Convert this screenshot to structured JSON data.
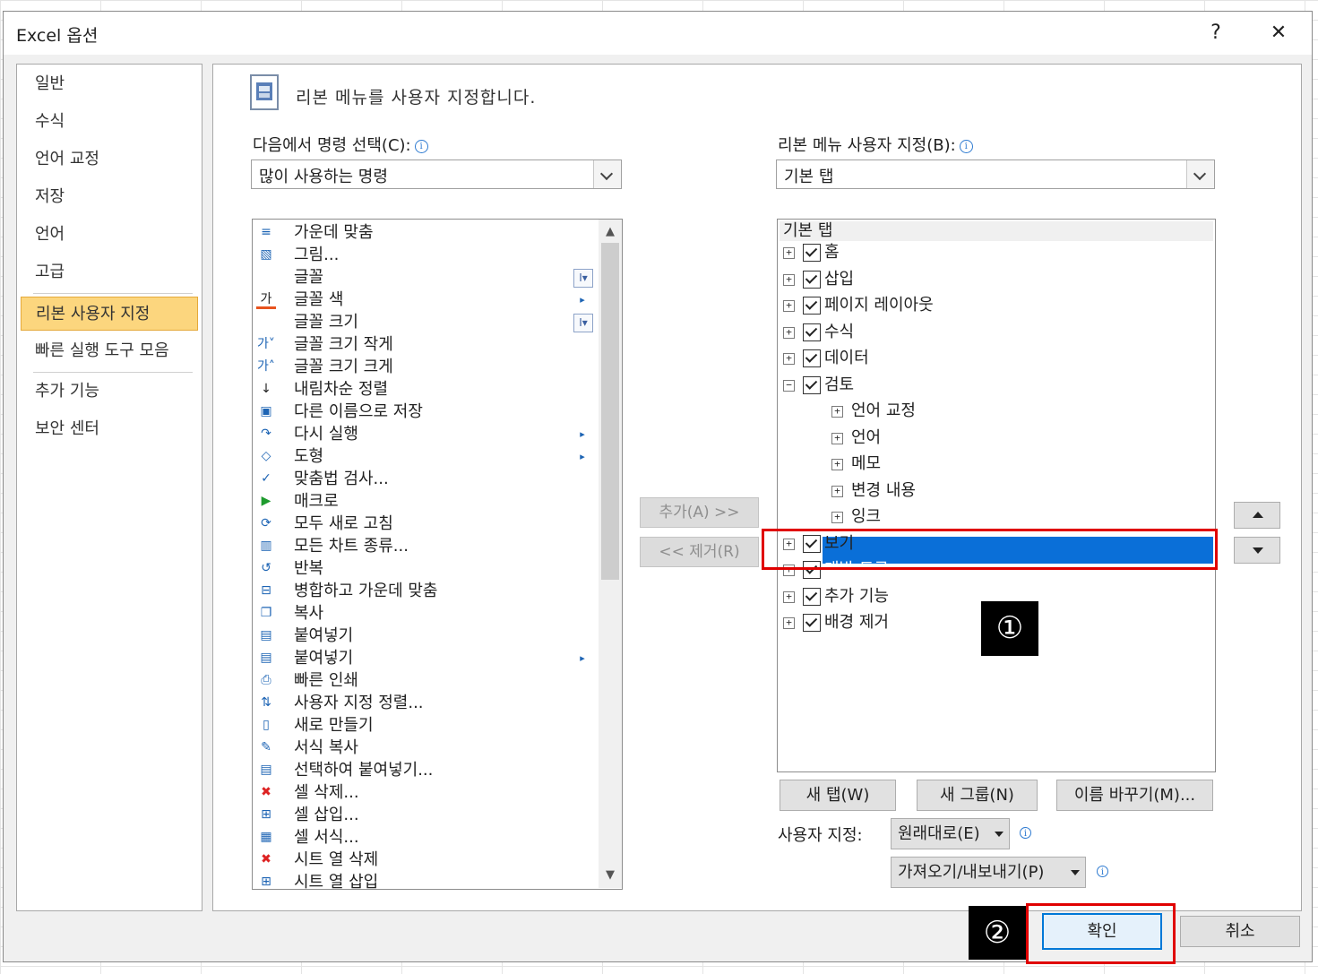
{
  "dialog": {
    "title": "Excel 옵션",
    "help": "?",
    "close": "✕"
  },
  "nav": {
    "items": [
      {
        "label": "일반"
      },
      {
        "label": "수식"
      },
      {
        "label": "언어 교정"
      },
      {
        "label": "저장"
      },
      {
        "label": "언어"
      },
      {
        "label": "고급"
      },
      {
        "label": "리본 사용자 지정",
        "selected": true
      },
      {
        "label": "빠른 실행 도구 모음"
      },
      {
        "label": "추가 기능"
      },
      {
        "label": "보안 센터"
      }
    ]
  },
  "main": {
    "heading": "리본 메뉴를 사용자 지정합니다.",
    "left_label": "다음에서 명령 선택(C):",
    "left_combo": "많이 사용하는 명령",
    "right_label": "리본 메뉴 사용자 지정(B):",
    "right_combo": "기본 탭",
    "info_glyph": "i"
  },
  "commands": [
    {
      "icon": "align-center-icon",
      "glyph": "≡",
      "label": "가운데 맞춤"
    },
    {
      "icon": "picture-icon",
      "glyph": "▧",
      "label": "그림..."
    },
    {
      "icon": "",
      "glyph": "",
      "label": "글꼴",
      "sub": "I▾"
    },
    {
      "icon": "font-color-icon",
      "glyph": "가",
      "label": "글꼴 색",
      "sub": "▸"
    },
    {
      "icon": "",
      "glyph": "",
      "label": "글꼴 크기",
      "sub": "I▾"
    },
    {
      "icon": "font-smaller-icon",
      "glyph": "가˅",
      "label": "글꼴 크기 작게"
    },
    {
      "icon": "font-larger-icon",
      "glyph": "가˄",
      "label": "글꼴 크기 크게"
    },
    {
      "icon": "sort-desc-icon",
      "glyph": "↓",
      "label": "내림차순 정렬"
    },
    {
      "icon": "save-as-icon",
      "glyph": "▣",
      "label": "다른 이름으로 저장"
    },
    {
      "icon": "redo-icon",
      "glyph": "↷",
      "label": "다시 실행",
      "sub": "▸"
    },
    {
      "icon": "shapes-icon",
      "glyph": "◇",
      "label": "도형",
      "sub": "▸"
    },
    {
      "icon": "spelling-icon",
      "glyph": "✓",
      "label": "맞춤법 검사..."
    },
    {
      "icon": "macro-icon",
      "glyph": "▶",
      "label": "매크로"
    },
    {
      "icon": "refresh-all-icon",
      "glyph": "⟳",
      "label": "모두 새로 고침"
    },
    {
      "icon": "chart-types-icon",
      "glyph": "▥",
      "label": "모든 차트 종류..."
    },
    {
      "icon": "repeat-icon",
      "glyph": "↺",
      "label": "반복"
    },
    {
      "icon": "merge-center-icon",
      "glyph": "⊟",
      "label": "병합하고 가운데 맞춤"
    },
    {
      "icon": "copy-icon",
      "glyph": "❐",
      "label": "복사"
    },
    {
      "icon": "paste-icon",
      "glyph": "▤",
      "label": "붙여넣기"
    },
    {
      "icon": "paste-menu-icon",
      "glyph": "▤",
      "label": "붙여넣기",
      "sub": "▸"
    },
    {
      "icon": "quick-print-icon",
      "glyph": "⎙",
      "label": "빠른 인쇄"
    },
    {
      "icon": "custom-sort-icon",
      "glyph": "⇅",
      "label": "사용자 지정 정렬..."
    },
    {
      "icon": "new-document-icon",
      "glyph": "▯",
      "label": "새로 만들기"
    },
    {
      "icon": "format-painter-icon",
      "glyph": "✎",
      "label": "서식 복사"
    },
    {
      "icon": "paste-special-icon",
      "glyph": "▤",
      "label": "선택하여 붙여넣기..."
    },
    {
      "icon": "delete-cells-icon",
      "glyph": "✖",
      "label": "셀 삭제..."
    },
    {
      "icon": "insert-cells-icon",
      "glyph": "⊞",
      "label": "셀 삽입..."
    },
    {
      "icon": "format-cells-icon",
      "glyph": "▦",
      "label": "셀 서식..."
    },
    {
      "icon": "delete-sheet-columns-icon",
      "glyph": "✖",
      "label": "시트 열 삭제"
    },
    {
      "icon": "insert-sheet-columns-icon",
      "glyph": "⊞",
      "label": "시트 열 삽입"
    }
  ],
  "mid_buttons": {
    "add": "추가(A) >>",
    "remove": "<< 제거(R)"
  },
  "tree": {
    "header": "기본 탭",
    "rows": [
      {
        "level": 0,
        "exp": "+",
        "checked": true,
        "label": "홈"
      },
      {
        "level": 0,
        "exp": "+",
        "checked": true,
        "label": "삽입"
      },
      {
        "level": 0,
        "exp": "+",
        "checked": true,
        "label": "페이지 레이아웃"
      },
      {
        "level": 0,
        "exp": "+",
        "checked": true,
        "label": "수식"
      },
      {
        "level": 0,
        "exp": "+",
        "checked": true,
        "label": "데이터"
      },
      {
        "level": 0,
        "exp": "−",
        "checked": true,
        "label": "검토"
      },
      {
        "level": 1,
        "exp": "+",
        "label": "언어 교정"
      },
      {
        "level": 1,
        "exp": "+",
        "label": "언어"
      },
      {
        "level": 1,
        "exp": "+",
        "label": "메모"
      },
      {
        "level": 1,
        "exp": "+",
        "label": "변경 내용"
      },
      {
        "level": 1,
        "exp": "+",
        "label": "잉크"
      },
      {
        "level": 0,
        "exp": "+",
        "checked": true,
        "label": "보기"
      },
      {
        "level": 0,
        "exp": "+",
        "checked": true,
        "label": "개발 도구",
        "selected": true
      },
      {
        "level": 0,
        "exp": "+",
        "checked": true,
        "label": "추가 기능"
      },
      {
        "level": 0,
        "exp": "+",
        "checked": true,
        "label": "배경 제거"
      }
    ]
  },
  "bottom": {
    "new_tab": "새 탭(W)",
    "new_group": "새 그룹(N)",
    "rename": "이름 바꾸기(M)...",
    "customize_label": "사용자 지정:",
    "reset": "원래대로(E)",
    "import_export": "가져오기/내보내기(P)"
  },
  "footer": {
    "ok": "확인",
    "cancel": "취소"
  },
  "markers": {
    "one": "①",
    "two": "②"
  },
  "colors": {
    "selection": "#0a6fd8",
    "nav_selected": "#fcd67e",
    "highlight_box": "#e00000"
  }
}
